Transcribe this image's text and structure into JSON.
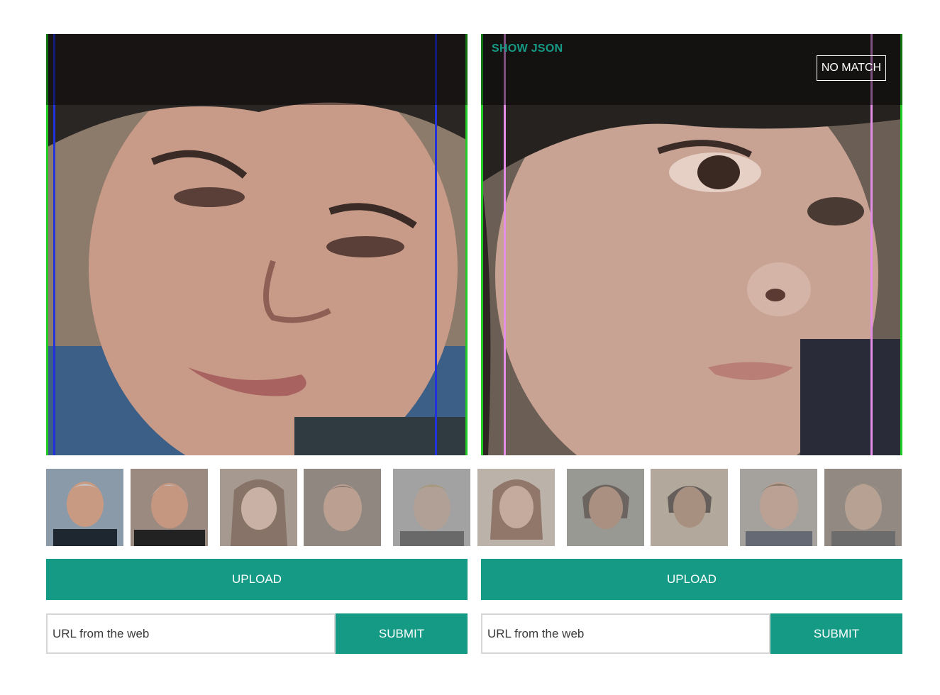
{
  "left_panel": {
    "frame_color": "#22cc22",
    "bounding_line_color": "#2233dd"
  },
  "right_panel": {
    "show_json_label": "SHOW JSON",
    "result_label": "NO MATCH",
    "frame_color": "#22cc22",
    "bounding_line_color": "#e58ee8"
  },
  "thumbnails": [
    {
      "name": "thumb-man-gray-hair-1",
      "dimmed": false
    },
    {
      "name": "thumb-man-gray-hair-2",
      "dimmed": false
    },
    {
      "name": "thumb-woman-brown-hair-1",
      "dimmed": true
    },
    {
      "name": "thumb-man-stubble-1",
      "dimmed": true
    },
    {
      "name": "thumb-man-blond-1",
      "dimmed": true
    },
    {
      "name": "thumb-woman-brown-hair-2",
      "dimmed": true
    },
    {
      "name": "thumb-woman-short-hair-1",
      "dimmed": true
    },
    {
      "name": "thumb-woman-short-hair-2",
      "dimmed": true
    },
    {
      "name": "thumb-man-stubble-2",
      "dimmed": true
    },
    {
      "name": "thumb-man-blond-2",
      "dimmed": true
    }
  ],
  "left_controls": {
    "upload_label": "UPLOAD",
    "url_placeholder": "URL from the web",
    "submit_label": "SUBMIT"
  },
  "right_controls": {
    "upload_label": "UPLOAD",
    "url_placeholder": "URL from the web",
    "submit_label": "SUBMIT"
  },
  "colors": {
    "accent": "#159a85"
  }
}
